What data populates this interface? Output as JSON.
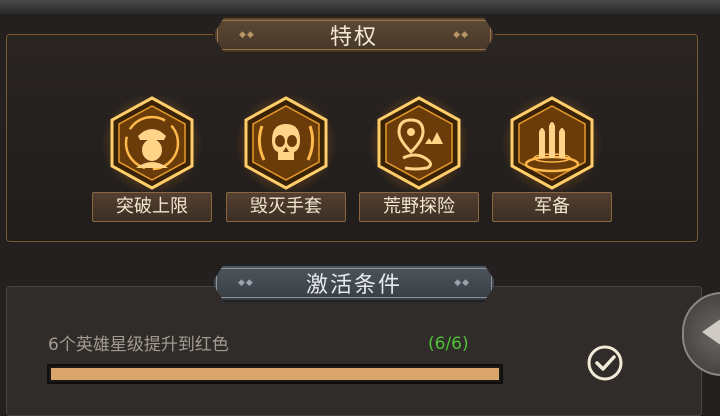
{
  "privileges_section": {
    "title": "特权",
    "items": [
      {
        "label": "突破上限",
        "icon": "soldier-portrait-icon"
      },
      {
        "label": "毁灭手套",
        "icon": "skull-icon"
      },
      {
        "label": "荒野探险",
        "icon": "map-pin-mountain-icon"
      },
      {
        "label": "军备",
        "icon": "bullets-icon"
      }
    ]
  },
  "conditions_section": {
    "title": "激活条件",
    "conditions": [
      {
        "text": "6个英雄星级提升到红色",
        "progress_text": "(6/6)",
        "progress": 1.0,
        "completed": true
      }
    ]
  },
  "colors": {
    "accent_gold": "#f0a63a",
    "progress_fill": "#d9a56a",
    "progress_count": "#4fc238"
  }
}
